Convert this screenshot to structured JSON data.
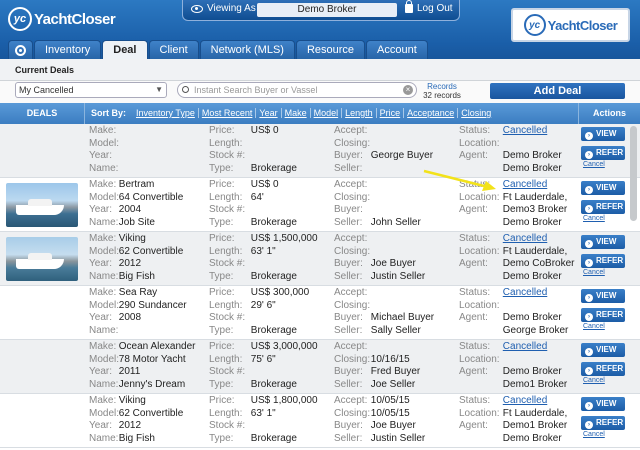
{
  "app": {
    "logo_text": "YachtCloser",
    "brand_text": "YachtCloser"
  },
  "topbar": {
    "viewing_label": "Viewing As",
    "broker": "Demo Broker",
    "logout_label": "Log Out"
  },
  "tabs": [
    "Inventory",
    "Deal",
    "Client",
    "Network (MLS)",
    "Resource",
    "Account"
  ],
  "active_tab": "Deal",
  "subnav": {
    "current": "Current Deals"
  },
  "toolbar": {
    "filter_value": "My Cancelled",
    "search_placeholder": "Instant Search Buyer or Vassel",
    "records_label": "Records",
    "records_count": "32 records",
    "add_deal": "Add Deal"
  },
  "header": {
    "deals": "DEALS",
    "sort_by": "Sort By:",
    "actions": "Actions",
    "sorts": [
      "Inventory Type",
      "Most Recent",
      "Year",
      "Make",
      "Model",
      "Length",
      "Price",
      "Acceptance",
      "Closing"
    ]
  },
  "labels": {
    "make": "Make:",
    "model": "Model:",
    "year": "Year:",
    "name": "Name:",
    "price": "Price:",
    "length": "Length:",
    "stock": "Stock #:",
    "type": "Type:",
    "accept": "Accept:",
    "closing": "Closing:",
    "buyer": "Buyer:",
    "seller": "Seller:",
    "status": "Status:",
    "location": "Location:",
    "agent": "Agent:",
    "view": "VIEW",
    "refer": "REFER",
    "cancel": "Cancel"
  },
  "deals": [
    {
      "make": "",
      "model": "",
      "year": "",
      "name": "",
      "price": "US$ 0",
      "length": "",
      "stock": "",
      "type": "Brokerage",
      "accept": "",
      "closing": "",
      "buyer": "George Buyer",
      "seller": "",
      "status": "Cancelled",
      "location": "",
      "agent": "Demo Broker",
      "agent2": "Demo Broker",
      "photo": ""
    },
    {
      "make": "Bertram",
      "model": "64 Convertible",
      "year": "2004",
      "name": "Job Site",
      "price": "US$ 0",
      "length": "64'",
      "stock": "",
      "type": "Brokerage",
      "accept": "",
      "closing": "",
      "buyer": "",
      "seller": "John Seller",
      "status": "Cancelled",
      "location": "Ft Lauderdale,",
      "agent": "Demo3 Broker",
      "agent2": "Demo Broker",
      "photo": "yes"
    },
    {
      "make": "Viking",
      "model": "62 Convertible",
      "year": "2012",
      "name": "Big Fish",
      "price": "US$ 1,500,000",
      "length": "63' 1\"",
      "stock": "",
      "type": "Brokerage",
      "accept": "",
      "closing": "",
      "buyer": "Joe Buyer",
      "seller": "Justin Seller",
      "status": "Cancelled",
      "location": "Ft Lauderdale,",
      "agent": "Demo CoBroker",
      "agent2": "Demo Broker",
      "photo": "yes"
    },
    {
      "make": "Sea Ray",
      "model": "290 Sundancer",
      "year": "2008",
      "name": "",
      "price": "US$ 300,000",
      "length": "29' 6\"",
      "stock": "",
      "type": "Brokerage",
      "accept": "",
      "closing": "",
      "buyer": "Michael Buyer",
      "seller": "Sally Seller",
      "status": "Cancelled",
      "location": "",
      "agent": "Demo Broker",
      "agent2": "George Broker",
      "photo": ""
    },
    {
      "make": "Ocean Alexander",
      "model": "78 Motor Yacht",
      "year": "2011",
      "name": "Jenny's Dream",
      "price": "US$ 3,000,000",
      "length": "75' 6\"",
      "stock": "",
      "type": "Brokerage",
      "accept": "",
      "closing": "10/16/15",
      "buyer": "Fred Buyer",
      "seller": "Joe Seller",
      "status": "Cancelled",
      "location": "",
      "agent": "Demo Broker",
      "agent2": "Demo1 Broker",
      "photo": ""
    },
    {
      "make": "Viking",
      "model": "62 Convertible",
      "year": "2012",
      "name": "Big Fish",
      "price": "US$ 1,800,000",
      "length": "63' 1\"",
      "stock": "",
      "type": "Brokerage",
      "accept": "10/05/15",
      "closing": "10/05/15",
      "buyer": "Joe Buyer",
      "seller": "Justin Seller",
      "status": "Cancelled",
      "location": "Ft Lauderdale,",
      "agent": "Demo1 Broker",
      "agent2": "Demo Broker",
      "photo": ""
    }
  ]
}
